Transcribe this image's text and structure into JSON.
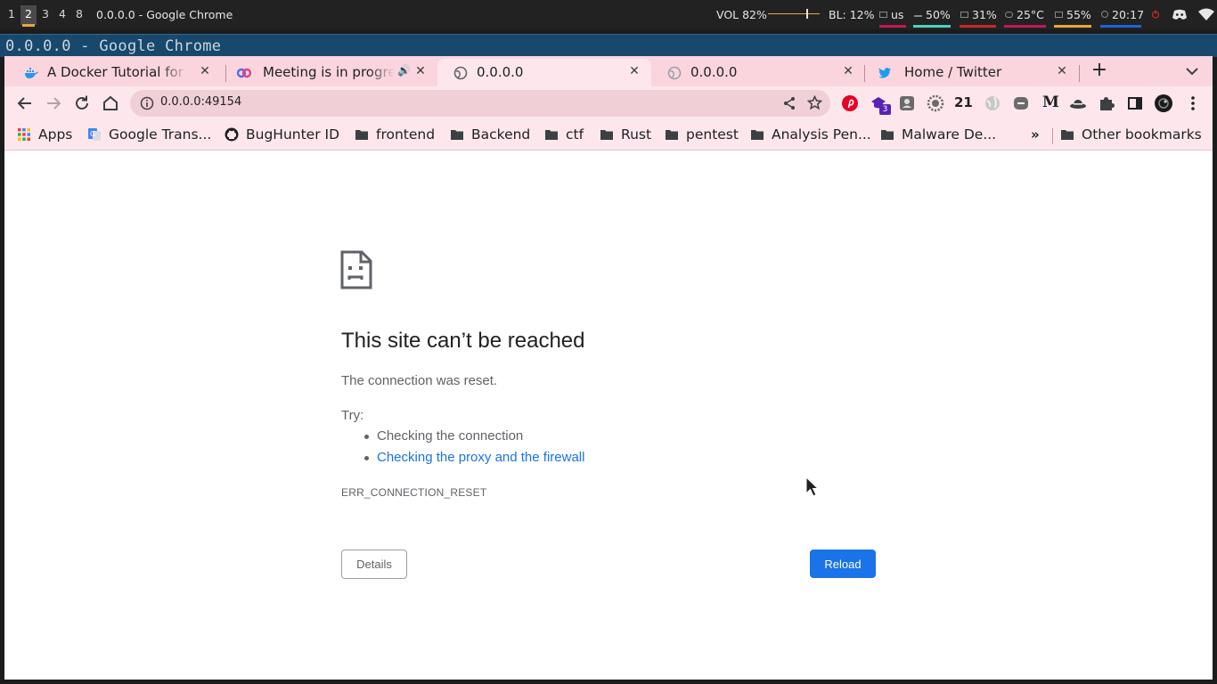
{
  "statusbar": {
    "workspaces": [
      "1",
      "2",
      "3",
      "4",
      "8"
    ],
    "active_workspace": "2",
    "window_title": "0.0.0.0 - Google Chrome",
    "volume": "VOL 82%",
    "volume_level": 0.82,
    "backlight": "BL: 12%",
    "keyboard": "us",
    "memory": "50%",
    "cpu": "31%",
    "temperature": "25°C",
    "disk": "55%",
    "clock": "20:17",
    "colors": {
      "workspace_accent": "#e8a735",
      "keyboard": "#c2185b",
      "memory": "#4dd0c4",
      "cpu": "#c62828",
      "temp": "#c2185b",
      "disk": "#e8a735",
      "clock": "#1e63d6"
    }
  },
  "window_titlebar": "0.0.0.0 - Google Chrome",
  "tabs": [
    {
      "label": "A Docker Tutorial for B",
      "icon": "docker-icon",
      "active": false
    },
    {
      "label": "Meeting is in progre",
      "icon": "meet-icon",
      "active": false,
      "audio": true
    },
    {
      "label": "0.0.0.0",
      "icon": "globe-icon",
      "active": true
    },
    {
      "label": "0.0.0.0",
      "icon": "globe-icon",
      "active": false
    },
    {
      "label": "Home / Twitter",
      "icon": "twitter-icon",
      "active": false
    }
  ],
  "toolbar": {
    "url": "0.0.0.0:49154",
    "extension_badge": "3",
    "extension_counter": "21",
    "extension_m": "M"
  },
  "bookmarks": {
    "items": [
      {
        "label": "Apps",
        "icon": "apps-grid-icon"
      },
      {
        "label": "Google Trans...",
        "icon": "google-translate-icon"
      },
      {
        "label": "BugHunter ID",
        "icon": "github-icon"
      },
      {
        "label": "frontend",
        "icon": "folder-icon"
      },
      {
        "label": "Backend",
        "icon": "folder-icon"
      },
      {
        "label": "ctf",
        "icon": "folder-icon"
      },
      {
        "label": "Rust",
        "icon": "folder-icon"
      },
      {
        "label": "pentest",
        "icon": "folder-icon"
      },
      {
        "label": "Analysis Pen...",
        "icon": "folder-icon"
      },
      {
        "label": "Malware De...",
        "icon": "folder-icon"
      }
    ],
    "overflow": "»",
    "other": "Other bookmarks"
  },
  "error_page": {
    "title": "This site can’t be reached",
    "description": "The connection was reset.",
    "try_label": "Try:",
    "suggestions": [
      "Checking the connection",
      "Checking the proxy and the firewall"
    ],
    "error_code": "ERR_CONNECTION_RESET",
    "details_button": "Details",
    "reload_button": "Reload"
  },
  "colors": {
    "tabstrip_bg": "#fbd5dd",
    "toolbar_bg": "#fde7ec",
    "link": "#1a73e8",
    "reload_button": "#1a73e8"
  }
}
